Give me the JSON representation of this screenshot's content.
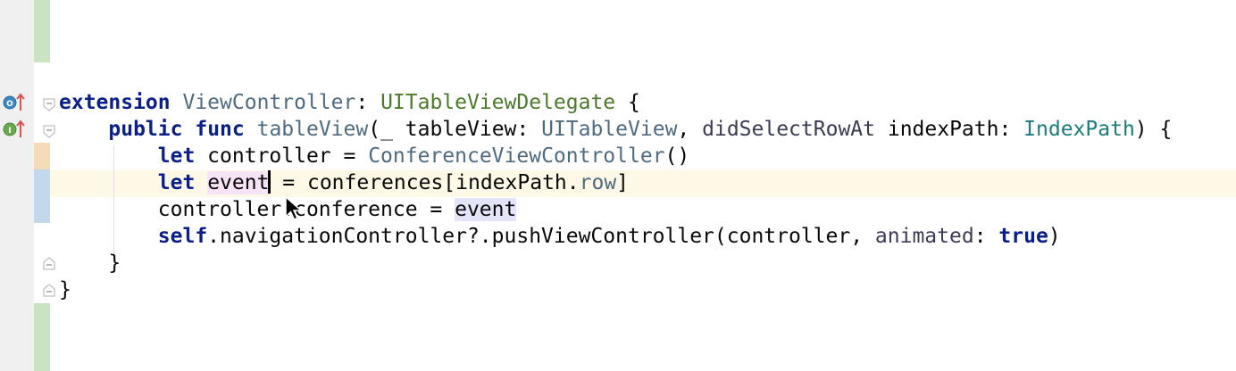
{
  "editor": {
    "lines": [
      {
        "parts": [
          {
            "t": "extension",
            "c": "kw"
          },
          {
            "t": " "
          },
          {
            "t": "ViewController",
            "c": "type-gray"
          },
          {
            "t": ": "
          },
          {
            "t": "UITableViewDelegate",
            "c": "type-green"
          },
          {
            "t": " {"
          }
        ]
      },
      {
        "parts": [
          {
            "t": "    "
          },
          {
            "t": "public",
            "c": "kw"
          },
          {
            "t": " "
          },
          {
            "t": "func",
            "c": "kw"
          },
          {
            "t": " "
          },
          {
            "t": "tableView",
            "c": "type-gray"
          },
          {
            "t": "(_ tableView: "
          },
          {
            "t": "UITableView",
            "c": "type-gray"
          },
          {
            "t": ", "
          },
          {
            "t": "didSelectRowAt",
            "c": "param"
          },
          {
            "t": " indexPath: "
          },
          {
            "t": "IndexPath",
            "c": "type-teal"
          },
          {
            "t": ") {"
          }
        ]
      },
      {
        "parts": [
          {
            "t": "        "
          },
          {
            "t": "let",
            "c": "kw"
          },
          {
            "t": " controller = "
          },
          {
            "t": "ConferenceViewController",
            "c": "type-gray"
          },
          {
            "t": "()"
          }
        ]
      },
      {
        "parts": [
          {
            "t": "        "
          },
          {
            "t": "let",
            "c": "kw"
          },
          {
            "t": " "
          },
          {
            "t": "event",
            "c": "hl-write"
          },
          {
            "caret": true
          },
          {
            "t": " = conferences[indexPath."
          },
          {
            "t": "row",
            "c": "type-gray"
          },
          {
            "t": "]"
          }
        ]
      },
      {
        "parts": [
          {
            "t": "        controller.conference = "
          },
          {
            "t": "event",
            "c": "hl-read"
          }
        ]
      },
      {
        "parts": [
          {
            "t": "        "
          },
          {
            "t": "self",
            "c": "kw"
          },
          {
            "t": ".navigationController?.pushViewController(controller, "
          },
          {
            "t": "animated",
            "c": "param"
          },
          {
            "t": ": "
          },
          {
            "t": "true",
            "c": "kw"
          },
          {
            "t": ")"
          }
        ]
      },
      {
        "parts": [
          {
            "t": "    }"
          }
        ]
      },
      {
        "parts": [
          {
            "t": "}"
          }
        ]
      }
    ]
  },
  "gutter": {
    "line_markers": [
      "overridden-method-up-icon",
      "implementing-method-up-icon"
    ],
    "marker_letters": [
      "O",
      "I"
    ]
  },
  "colors": {
    "vcs_green": "#c9e4c3",
    "vcs_orange": "#f5dcb8",
    "vcs_blue": "#c3d8ec",
    "caret_line": "#fdf9e6",
    "keyword": "#0b1f8a"
  }
}
